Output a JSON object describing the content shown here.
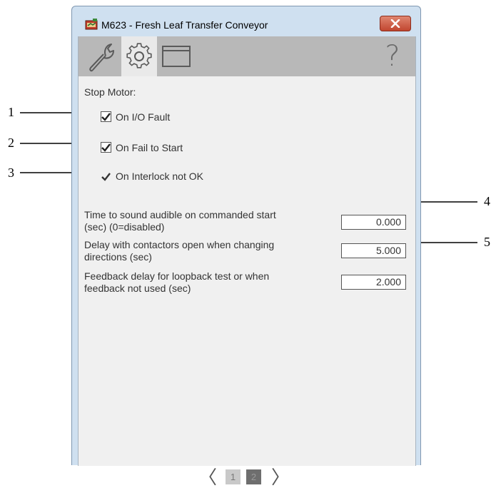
{
  "window": {
    "title": "M623 - Fresh Leaf Transfer Conveyor",
    "help_glyph": "?"
  },
  "toolbar": {
    "tabs": [
      {
        "icon": "wrench-icon",
        "active": false
      },
      {
        "icon": "gear-icon",
        "active": true
      },
      {
        "icon": "window-icon",
        "active": false
      }
    ]
  },
  "stop_motor": {
    "heading": "Stop Motor:",
    "options": [
      {
        "label": "On I/O Fault",
        "checked": true,
        "style": "checkbox"
      },
      {
        "label": "On Fail to Start",
        "checked": true,
        "style": "checkbox"
      },
      {
        "label": "On Interlock not OK",
        "checked": true,
        "style": "checkmark"
      }
    ]
  },
  "settings": [
    {
      "line1": "Time to sound audible on commanded start",
      "line2": "(sec) (0=disabled)",
      "value": "0.000"
    },
    {
      "line1": "Delay with contactors open when changing",
      "line2": "directions (sec)",
      "value": "5.000"
    },
    {
      "line1": "Feedback delay for loopback test or when",
      "line2": "feedback not used (sec)",
      "value": "2.000"
    }
  ],
  "pager": {
    "prev": "〈",
    "next": "〉",
    "pages": [
      "1",
      "2"
    ],
    "current": "2"
  },
  "callouts": [
    "1",
    "2",
    "3",
    "4",
    "5"
  ]
}
